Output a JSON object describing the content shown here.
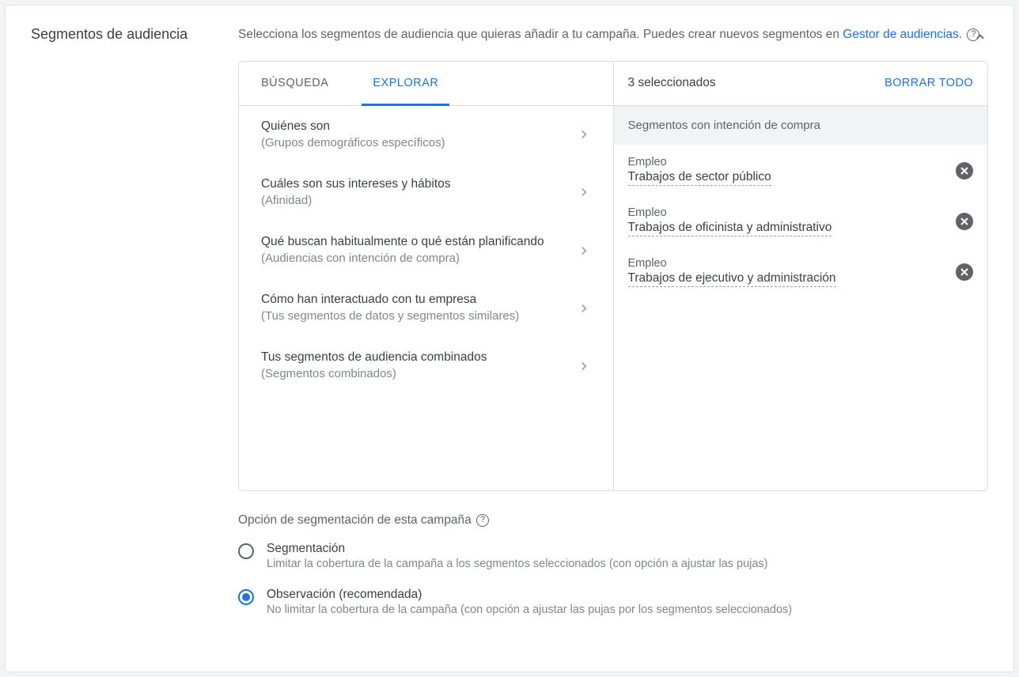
{
  "section_title": "Segmentos de audiencia",
  "intro_text_1": "Selecciona los segmentos de audiencia que quieras añadir a tu campaña. Puedes crear nuevos segmentos en ",
  "intro_link": "Gestor de audiencias",
  "intro_text_2": ".",
  "tabs": {
    "search": "BÚSQUEDA",
    "explore": "EXPLORAR"
  },
  "explore_items": [
    {
      "title": "Quiénes son",
      "sub": "(Grupos demográficos específicos)"
    },
    {
      "title": "Cuáles son sus intereses y hábitos",
      "sub": "(Afinidad)"
    },
    {
      "title": "Qué buscan habitualmente o qué están planificando",
      "sub": "(Audiencias con intención de compra)"
    },
    {
      "title": "Cómo han interactuado con tu empresa",
      "sub": "(Tus segmentos de datos y segmentos similares)"
    },
    {
      "title": "Tus segmentos de audiencia combinados",
      "sub": "(Segmentos combinados)"
    }
  ],
  "selected_count": "3 seleccionados",
  "clear_all": "BORRAR TODO",
  "group_header": "Segmentos con intención de compra",
  "selected_items": [
    {
      "cat": "Empleo",
      "name": "Trabajos de sector público"
    },
    {
      "cat": "Empleo",
      "name": "Trabajos de oficinista y administrativo"
    },
    {
      "cat": "Empleo",
      "name": "Trabajos de ejecutivo y administración"
    }
  ],
  "targeting": {
    "title": "Opción de segmentación de esta campaña",
    "opt1_title": "Segmentación",
    "opt1_sub": "Limitar la cobertura de la campaña a los segmentos seleccionados (con opción a ajustar las pujas)",
    "opt2_title": "Observación (recomendada)",
    "opt2_sub": "No limitar la cobertura de la campaña (con opción a ajustar las pujas por los segmentos seleccionados)"
  }
}
